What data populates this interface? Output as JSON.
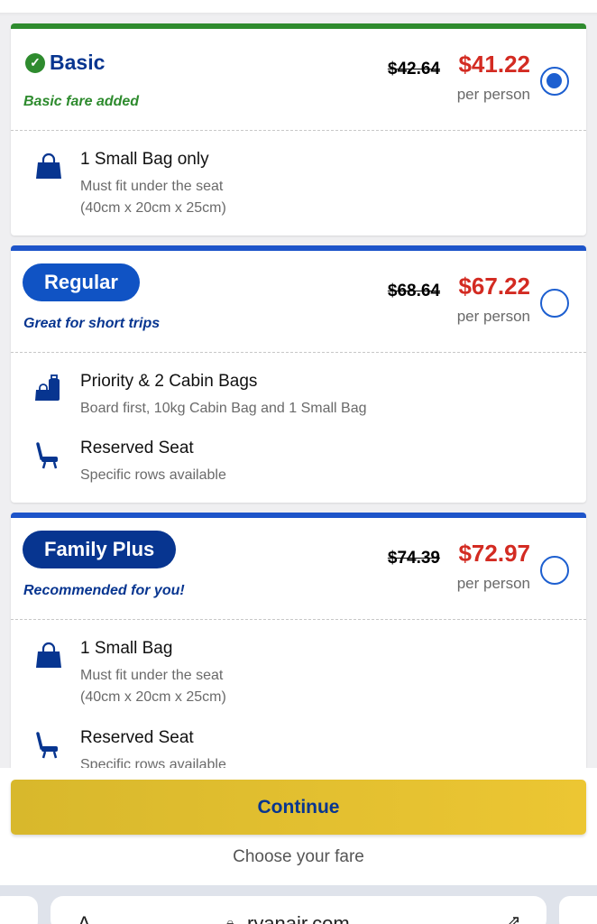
{
  "colors": {
    "brand_blue": "#073590",
    "accent_blue": "#1d54c9",
    "green": "#2e8b2e",
    "price_red": "#d32b22",
    "continue_yellow": "#ecc633"
  },
  "fares": [
    {
      "name": "Basic",
      "subtitle": "Basic fare added",
      "old_price": "$42.64",
      "new_price": "$41.22",
      "per_person": "per person",
      "selected": true,
      "features": [
        {
          "icon": "small-bag-icon",
          "title": "1 Small Bag only",
          "desc": "Must fit under the seat",
          "desc2": "(40cm x 20cm x 25cm)"
        }
      ]
    },
    {
      "name": "Regular",
      "subtitle": "Great for short trips",
      "old_price": "$68.64",
      "new_price": "$67.22",
      "per_person": "per person",
      "selected": false,
      "features": [
        {
          "icon": "priority-bags-icon",
          "title": "Priority & 2 Cabin Bags",
          "desc": "Board first, 10kg Cabin Bag and 1 Small Bag"
        },
        {
          "icon": "seat-icon",
          "title": "Reserved Seat",
          "desc": "Specific rows available"
        }
      ]
    },
    {
      "name": "Family Plus",
      "subtitle": "Recommended for you!",
      "old_price": "$74.39",
      "new_price": "$72.97",
      "per_person": "per person",
      "selected": false,
      "features": [
        {
          "icon": "small-bag-icon",
          "title": "1 Small Bag",
          "desc": "Must fit under the seat",
          "desc2": "(40cm x 20cm x 25cm)"
        },
        {
          "icon": "seat-icon",
          "title": "Reserved Seat",
          "desc": "Specific rows available"
        }
      ]
    }
  ],
  "footer": {
    "continue_label": "Continue",
    "hint": "Choose your fare"
  },
  "browser": {
    "url": "ryanair.com",
    "left_glyph": "A"
  }
}
